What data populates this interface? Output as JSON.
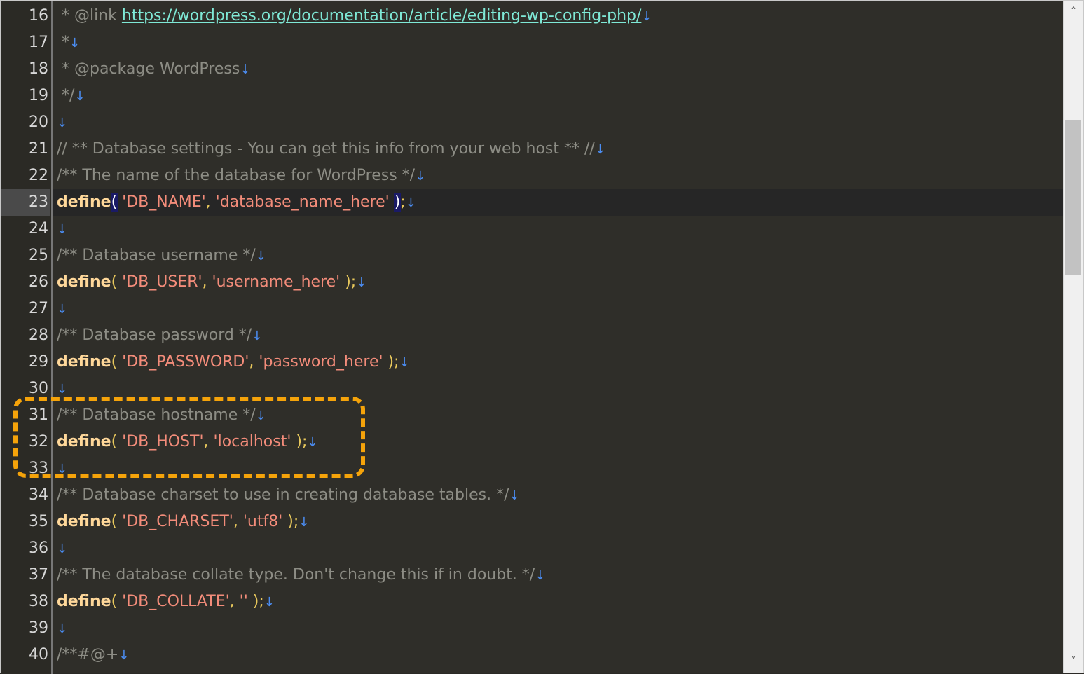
{
  "editor": {
    "lines": [
      {
        "n": "16",
        "parts": [
          {
            "c": "cm",
            "t": " * @link "
          },
          {
            "c": "url",
            "t": "https://wordpress.org/documentation/article/editing-wp-config-php/"
          }
        ]
      },
      {
        "n": "17",
        "parts": [
          {
            "c": "cm",
            "t": " *"
          }
        ]
      },
      {
        "n": "18",
        "parts": [
          {
            "c": "cm",
            "t": " * @package WordPress"
          }
        ]
      },
      {
        "n": "19",
        "parts": [
          {
            "c": "cm",
            "t": " */"
          }
        ]
      },
      {
        "n": "20",
        "parts": []
      },
      {
        "n": "21",
        "parts": [
          {
            "c": "cm",
            "t": "// ** Database settings - You can get this info from your web host ** //"
          }
        ]
      },
      {
        "n": "22",
        "parts": [
          {
            "c": "cm",
            "t": "/** The name of the database for WordPress */"
          }
        ]
      },
      {
        "n": "23",
        "current": true,
        "parts": [
          {
            "c": "kw define",
            "t": "define"
          },
          {
            "c": "bracket",
            "t": "("
          },
          {
            "c": "str",
            "t": " 'DB_NAME'"
          },
          {
            "c": "pn",
            "t": ", "
          },
          {
            "c": "str",
            "t": "'database_name_here' "
          },
          {
            "c": "bracket",
            "t": ")"
          },
          {
            "c": "pn",
            "t": ";"
          }
        ]
      },
      {
        "n": "24",
        "parts": []
      },
      {
        "n": "25",
        "parts": [
          {
            "c": "cm",
            "t": "/** Database username */"
          }
        ]
      },
      {
        "n": "26",
        "parts": [
          {
            "c": "kw define",
            "t": "define"
          },
          {
            "c": "pn",
            "t": "( "
          },
          {
            "c": "str",
            "t": "'DB_USER'"
          },
          {
            "c": "pn",
            "t": ", "
          },
          {
            "c": "str",
            "t": "'username_here'"
          },
          {
            "c": "pn",
            "t": " );"
          }
        ]
      },
      {
        "n": "27",
        "parts": []
      },
      {
        "n": "28",
        "parts": [
          {
            "c": "cm",
            "t": "/** Database password */"
          }
        ]
      },
      {
        "n": "29",
        "parts": [
          {
            "c": "kw define",
            "t": "define"
          },
          {
            "c": "pn",
            "t": "( "
          },
          {
            "c": "str",
            "t": "'DB_PASSWORD'"
          },
          {
            "c": "pn",
            "t": ", "
          },
          {
            "c": "str",
            "t": "'password_here'"
          },
          {
            "c": "pn",
            "t": " );"
          }
        ]
      },
      {
        "n": "30",
        "parts": []
      },
      {
        "n": "31",
        "parts": [
          {
            "c": "cm",
            "t": "/** Database hostname */"
          }
        ]
      },
      {
        "n": "32",
        "parts": [
          {
            "c": "kw define",
            "t": "define"
          },
          {
            "c": "pn",
            "t": "( "
          },
          {
            "c": "str",
            "t": "'DB_HOST'"
          },
          {
            "c": "pn",
            "t": ", "
          },
          {
            "c": "str",
            "t": "'localhost'"
          },
          {
            "c": "pn",
            "t": " );"
          }
        ]
      },
      {
        "n": "33",
        "parts": []
      },
      {
        "n": "34",
        "parts": [
          {
            "c": "cm",
            "t": "/** Database charset to use in creating database tables. */"
          }
        ]
      },
      {
        "n": "35",
        "parts": [
          {
            "c": "kw define",
            "t": "define"
          },
          {
            "c": "pn",
            "t": "( "
          },
          {
            "c": "str",
            "t": "'DB_CHARSET'"
          },
          {
            "c": "pn",
            "t": ", "
          },
          {
            "c": "str",
            "t": "'utf8'"
          },
          {
            "c": "pn",
            "t": " );"
          }
        ]
      },
      {
        "n": "36",
        "parts": []
      },
      {
        "n": "37",
        "parts": [
          {
            "c": "cm",
            "t": "/** The database collate type. Don't change this if in doubt. */"
          }
        ]
      },
      {
        "n": "38",
        "parts": [
          {
            "c": "kw define",
            "t": "define"
          },
          {
            "c": "pn",
            "t": "( "
          },
          {
            "c": "str",
            "t": "'DB_COLLATE'"
          },
          {
            "c": "pn",
            "t": ", "
          },
          {
            "c": "str",
            "t": "''"
          },
          {
            "c": "pn",
            "t": " );"
          }
        ]
      },
      {
        "n": "39",
        "parts": []
      },
      {
        "n": "40",
        "parts": [
          {
            "c": "cm",
            "t": "/**#@+"
          }
        ]
      }
    ],
    "newline_marker": "↓",
    "scroll_up_icon": "chevron-up-icon",
    "scroll_down_icon": "chevron-down-icon"
  },
  "colors": {
    "background": "#2f2e29",
    "comment": "#8d8d85",
    "keyword": "#ffd89a",
    "string": "#f38c7a",
    "url": "#7fe9d6",
    "newline_marker": "#4b8cf0",
    "highlight_box": "#f5a30a"
  }
}
